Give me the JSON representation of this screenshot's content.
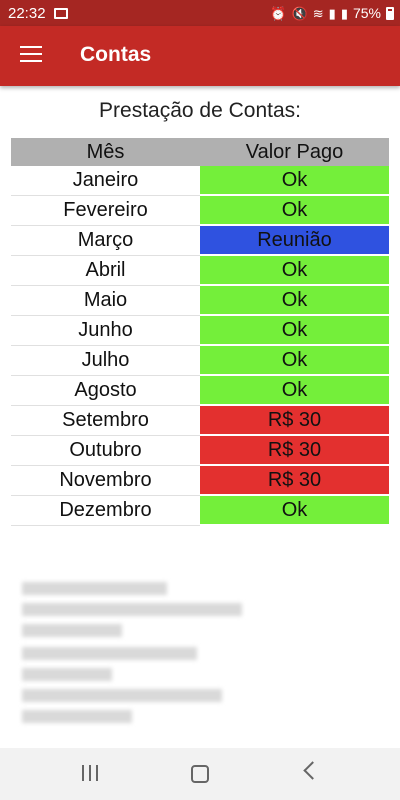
{
  "status_bar": {
    "time": "22:32",
    "battery": "75%",
    "icons": [
      "image-icon",
      "alarm-icon",
      "mute-icon",
      "wifi-icon",
      "signal-icon",
      "signal-icon",
      "battery-icon"
    ]
  },
  "app_bar": {
    "title": "Contas",
    "menu_icon": "hamburger-menu-icon"
  },
  "report": {
    "heading": "Prestação de Contas:",
    "columns": [
      "Mês",
      "Valor Pago"
    ],
    "rows": [
      {
        "month": "Janeiro",
        "value": "Ok",
        "status": "ok"
      },
      {
        "month": "Fevereiro",
        "value": "Ok",
        "status": "ok"
      },
      {
        "month": "Março",
        "value": "Reunião",
        "status": "meeting"
      },
      {
        "month": "Abril",
        "value": "Ok",
        "status": "ok"
      },
      {
        "month": "Maio",
        "value": "Ok",
        "status": "ok"
      },
      {
        "month": "Junho",
        "value": "Ok",
        "status": "ok"
      },
      {
        "month": "Julho",
        "value": "Ok",
        "status": "ok"
      },
      {
        "month": "Agosto",
        "value": "Ok",
        "status": "ok"
      },
      {
        "month": "Setembro",
        "value": "R$ 30",
        "status": "due"
      },
      {
        "month": "Outubro",
        "value": "R$ 30",
        "status": "due"
      },
      {
        "month": "Novembro",
        "value": "R$ 30",
        "status": "due"
      },
      {
        "month": "Dezembro",
        "value": "Ok",
        "status": "ok"
      }
    ]
  },
  "colors": {
    "status_bar": "#a52622",
    "app_bar": "#c32a25",
    "ok": "#74ef3a",
    "meeting": "#2f52e0",
    "due": "#e3302f",
    "header": "#b0b0b0"
  },
  "nav_bar": {
    "icons": [
      "recent-apps-icon",
      "home-icon",
      "back-icon"
    ]
  }
}
